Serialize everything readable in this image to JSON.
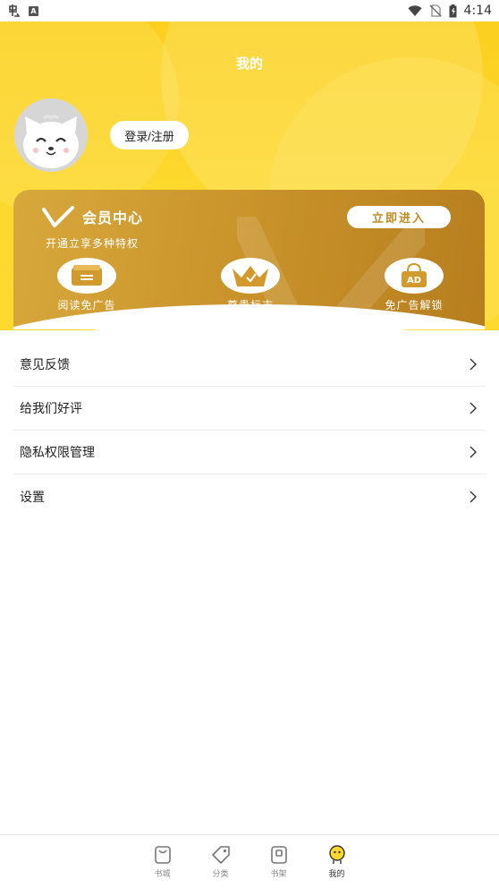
{
  "status_bar": {
    "time": "4:14",
    "left_icons": [
      "app-notification-icon",
      "a-box-icon"
    ],
    "right_icons": [
      "wifi-icon",
      "no-sim-icon",
      "battery-charging-icon"
    ]
  },
  "header": {
    "title": "我的",
    "login_label": "登录/注册",
    "bg_color": "#fdd82e"
  },
  "vip": {
    "title": "会员中心",
    "subtitle": "开通立享多种特权",
    "enter_label": "立即进入",
    "accent": "#c08a22",
    "perks": [
      {
        "label": "阅读免广告",
        "icon": "card-icon"
      },
      {
        "label": "尊贵标志",
        "icon": "crown-icon"
      },
      {
        "label": "免广告解锁",
        "icon": "ad-bag-icon"
      }
    ]
  },
  "menu": {
    "items": [
      {
        "label": "意见反馈"
      },
      {
        "label": "给我们好评"
      },
      {
        "label": "隐私权限管理"
      },
      {
        "label": "设置"
      }
    ]
  },
  "tabbar": {
    "tabs": [
      {
        "label": "书城",
        "icon": "bookstore-icon"
      },
      {
        "label": "分类",
        "icon": "tag-icon"
      },
      {
        "label": "书架",
        "icon": "bookshelf-icon"
      },
      {
        "label": "我的",
        "icon": "profile-icon",
        "active": true
      }
    ]
  }
}
